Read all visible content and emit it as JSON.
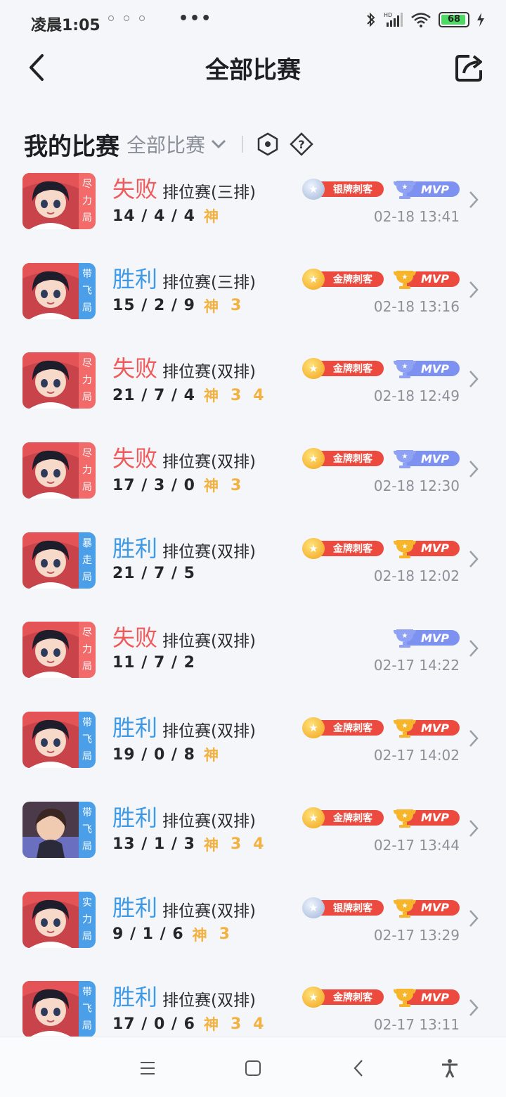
{
  "status_bar": {
    "time": "凌晨1:05",
    "more": "•••",
    "battery": "68",
    "hd": "HD"
  },
  "header": {
    "title": "全部比赛"
  },
  "filter": {
    "my_label": "我的比赛",
    "selected": "全部比赛"
  },
  "matches": [
    {
      "tag": [
        "尽",
        "力",
        "局"
      ],
      "tag_color": "red",
      "result": "失败",
      "result_type": "lose",
      "mode": "排位赛(三排)",
      "kda": "14 / 4 / 4",
      "god": "神",
      "nums": [],
      "medal": "silver",
      "medal_label": "银牌刺客",
      "mvp": "blue",
      "mvp_label": "MVP",
      "time": "02-18 13:41"
    },
    {
      "tag": [
        "带",
        "飞",
        "局"
      ],
      "tag_color": "blue",
      "result": "胜利",
      "result_type": "win",
      "mode": "排位赛(三排)",
      "kda": "15 / 2 / 9",
      "god": "神",
      "nums": [
        "3"
      ],
      "medal": "gold",
      "medal_label": "金牌刺客",
      "mvp": "gold",
      "mvp_label": "MVP",
      "time": "02-18 13:16"
    },
    {
      "tag": [
        "尽",
        "力",
        "局"
      ],
      "tag_color": "red",
      "result": "失败",
      "result_type": "lose",
      "mode": "排位赛(双排)",
      "kda": "21 / 7 / 4",
      "god": "神",
      "nums": [
        "3",
        "4"
      ],
      "medal": "gold",
      "medal_label": "金牌刺客",
      "mvp": "blue",
      "mvp_label": "MVP",
      "time": "02-18 12:49"
    },
    {
      "tag": [
        "尽",
        "力",
        "局"
      ],
      "tag_color": "red",
      "result": "失败",
      "result_type": "lose",
      "mode": "排位赛(双排)",
      "kda": "17 / 3 / 0",
      "god": "神",
      "nums": [
        "3"
      ],
      "medal": "gold",
      "medal_label": "金牌刺客",
      "mvp": "blue",
      "mvp_label": "MVP",
      "time": "02-18 12:30"
    },
    {
      "tag": [
        "暴",
        "走",
        "局"
      ],
      "tag_color": "blue",
      "result": "胜利",
      "result_type": "win",
      "mode": "排位赛(双排)",
      "kda": "21 / 7 / 5",
      "god": "",
      "nums": [],
      "medal": "gold",
      "medal_label": "金牌刺客",
      "mvp": "gold",
      "mvp_label": "MVP",
      "time": "02-18 12:02"
    },
    {
      "tag": [
        "尽",
        "力",
        "局"
      ],
      "tag_color": "red",
      "result": "失败",
      "result_type": "lose",
      "mode": "排位赛(双排)",
      "kda": "11 / 7 / 2",
      "god": "",
      "nums": [],
      "medal": "",
      "medal_label": "",
      "mvp": "blue",
      "mvp_label": "MVP",
      "time": "02-17 14:22"
    },
    {
      "tag": [
        "带",
        "飞",
        "局"
      ],
      "tag_color": "blue",
      "result": "胜利",
      "result_type": "win",
      "mode": "排位赛(双排)",
      "kda": "19 / 0 / 8",
      "god": "神",
      "nums": [],
      "medal": "gold",
      "medal_label": "金牌刺客",
      "mvp": "gold",
      "mvp_label": "MVP",
      "time": "02-17 14:02"
    },
    {
      "tag": [
        "带",
        "飞",
        "局"
      ],
      "tag_color": "blue",
      "result": "胜利",
      "result_type": "win",
      "mode": "排位赛(双排)",
      "kda": "13 / 1 / 3",
      "god": "神",
      "nums": [
        "3",
        "4"
      ],
      "medal": "gold",
      "medal_label": "金牌刺客",
      "mvp": "gold",
      "mvp_label": "MVP",
      "time": "02-17 13:44",
      "hero": "alt"
    },
    {
      "tag": [
        "实",
        "力",
        "局"
      ],
      "tag_color": "blue",
      "result": "胜利",
      "result_type": "win",
      "mode": "排位赛(双排)",
      "kda": "9 / 1 / 6",
      "god": "神",
      "nums": [
        "3"
      ],
      "medal": "silver",
      "medal_label": "银牌刺客",
      "mvp": "gold",
      "mvp_label": "MVP",
      "time": "02-17 13:29"
    },
    {
      "tag": [
        "带",
        "飞",
        "局"
      ],
      "tag_color": "blue",
      "result": "胜利",
      "result_type": "win",
      "mode": "排位赛(双排)",
      "kda": "17 / 0 / 6",
      "god": "神",
      "nums": [
        "3",
        "4"
      ],
      "medal": "gold",
      "medal_label": "金牌刺客",
      "mvp": "gold",
      "mvp_label": "MVP",
      "time": "02-17 13:11"
    }
  ],
  "icons": {
    "back": "back-arrow-icon",
    "share": "share-icon",
    "filter_hex": "hexagon-icon",
    "help": "help-icon",
    "nav": [
      "menu-icon",
      "home-icon",
      "back-icon",
      "accessibility-icon"
    ]
  },
  "colors": {
    "lose": "#f05a5a",
    "win": "#3c9ae8",
    "god": "#f3b13f",
    "bg": "#f5f6f9"
  }
}
